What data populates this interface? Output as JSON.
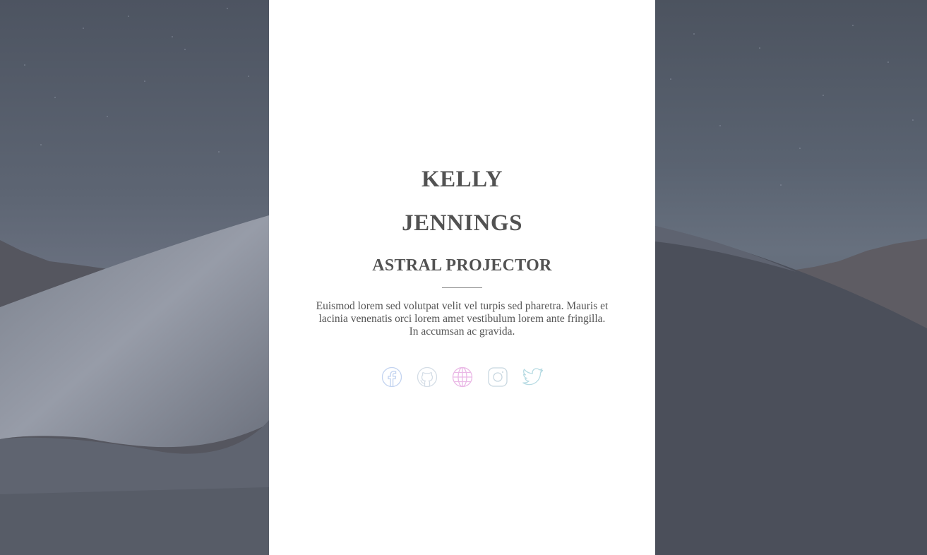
{
  "profile": {
    "first_name": "KELLY",
    "last_name": "JENNINGS",
    "role": "ASTRAL PROJECTOR",
    "bio": "Euismod lorem sed volutpat velit vel turpis sed pharetra. Mauris et lacinia venenatis orci lorem amet vestibulum lorem ante fringilla. In accumsan ac gravida."
  },
  "socials": [
    {
      "icon": "facebook-icon",
      "color": "#c2d3f0"
    },
    {
      "icon": "github-icon",
      "color": "#d4dde6"
    },
    {
      "icon": "globe-icon",
      "color": "#eab8e6"
    },
    {
      "icon": "instagram-icon",
      "color": "#c8d7e0"
    },
    {
      "icon": "twitter-icon",
      "color": "#b7dbe3"
    }
  ],
  "colors": {
    "background": "#4a4f5b",
    "card": "#ffffff",
    "text": "#525252"
  }
}
